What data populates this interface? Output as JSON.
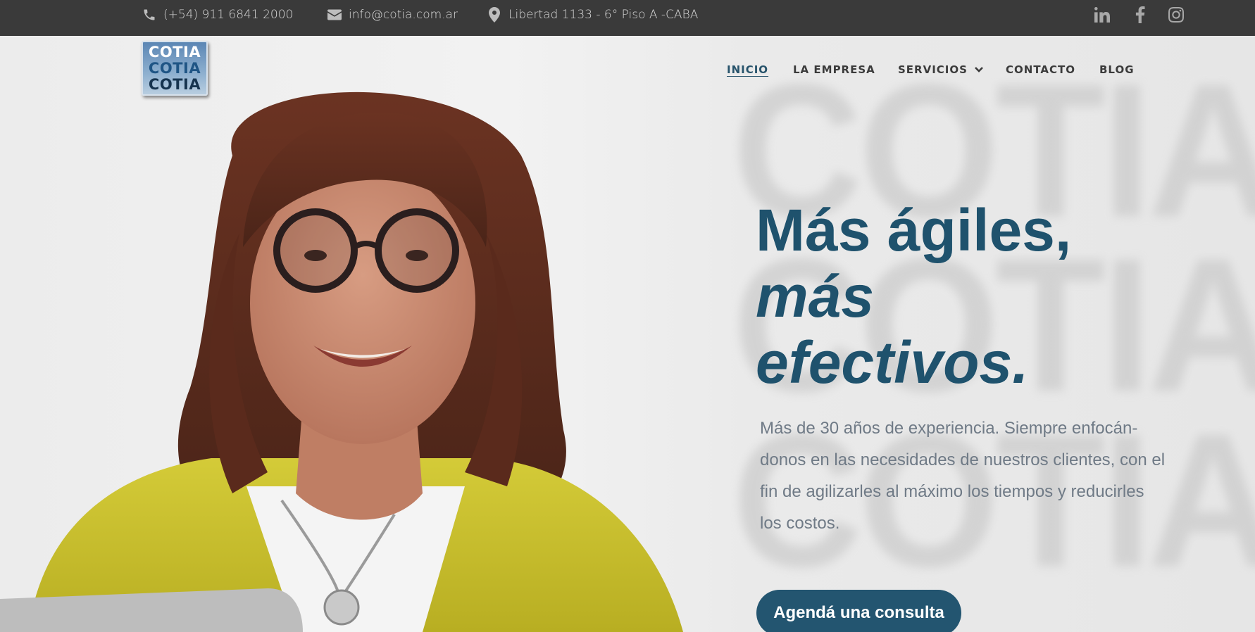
{
  "topbar": {
    "phone": "(+54) 911 6841 2000",
    "email": "info@cotia.com.ar",
    "address": "Libertad 1133 - 6° Piso A -CABA",
    "social": [
      "linkedin-icon",
      "facebook-icon",
      "instagram-icon"
    ]
  },
  "logo": {
    "lines": [
      "COTIA",
      "COTIA",
      "COTIA"
    ]
  },
  "nav": {
    "items": [
      {
        "label": "INICIO",
        "active": true
      },
      {
        "label": "LA EMPRESA"
      },
      {
        "label": "SERVICIOS",
        "has_dropdown": true
      },
      {
        "label": "CONTACTO"
      },
      {
        "label": "BLOG"
      }
    ]
  },
  "hero": {
    "headline_line1": "Más ágiles,",
    "headline_line2": "más",
    "headline_line3": "efectivos.",
    "subtext": "Más de 30 años de experiencia. Siempre enfocán­donos en las necesidades de nuestros clientes, con el fin de agilizarles al máximo los tiempos y reducir­les los costos.",
    "cta_label": "Agendá una consulta"
  },
  "colors": {
    "topbar_bg": "#3a3a3a",
    "accent": "#1f526d",
    "cta_bg": "#235570",
    "body_text": "#6f7a86"
  }
}
